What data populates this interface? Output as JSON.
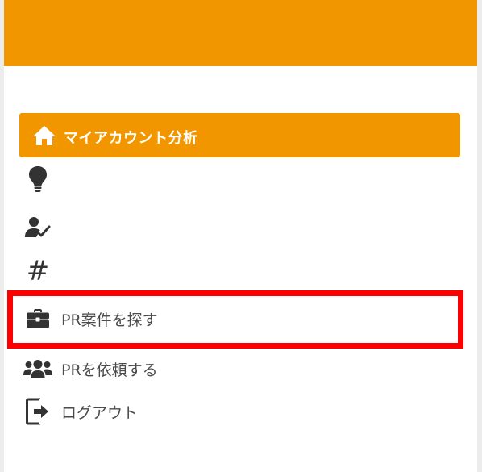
{
  "theme": {
    "accent": "#f29600",
    "text": "#4a4a4a",
    "highlight": "#ff0000"
  },
  "header": {
    "color": "#f29600"
  },
  "sidebar": {
    "items": [
      {
        "icon": "home-icon",
        "label": "マイアカウント分析",
        "active": true
      },
      {
        "icon": "lightbulb-icon",
        "label": ""
      },
      {
        "icon": "user-check-icon",
        "label": ""
      },
      {
        "icon": "hashtag-icon",
        "label": "",
        "glyph": "#"
      },
      {
        "icon": "briefcase-icon",
        "label": "PR案件を探す",
        "highlighted": true
      },
      {
        "icon": "users-icon",
        "label": "PRを依頼する"
      },
      {
        "icon": "logout-icon",
        "label": "ログアウト"
      }
    ]
  }
}
